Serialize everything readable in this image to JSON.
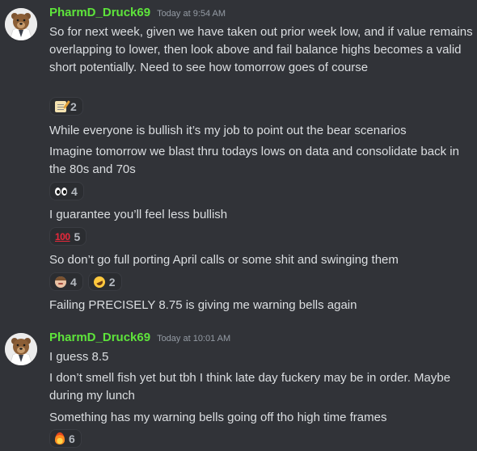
{
  "messages": [
    {
      "username": "PharmD_Druck69",
      "timestamp": "Today at 9:54 AM",
      "lines": [
        "So for next week, given we have taken out prior week low, and if value remains overlapping to lower, then look above and fail balance highs becomes a valid short potentially. Need to see how tomorrow goes of course",
        "While everyone is bullish it’s my job to point out the bear scenarios",
        "Imagine tomorrow we blast thru todays lows on data and consolidate back in the 80s and 70s",
        "I guarantee you’ll feel less bullish",
        "So don’t go full porting April calls or some shit and swinging them",
        "Failing PRECISELY 8.75 is giving me warning bells again"
      ],
      "reactions": [
        {
          "emoji": "memo-emoji",
          "count": "2"
        },
        {
          "emoji": "eyes-emoji",
          "count": "4"
        },
        {
          "emoji": "hundred-points-emoji",
          "count": "5"
        },
        {
          "emoji": "face-emoji",
          "count": "4"
        },
        {
          "emoji": "rolling-laughing-emoji",
          "count": "2"
        }
      ]
    },
    {
      "username": "PharmD_Druck69",
      "timestamp": "Today at 10:01 AM",
      "lines": [
        "I guess 8.5",
        "I don’t smell fish yet but tbh I think late day fuckery may be in order. Maybe during my lunch",
        "Something has my warning bells going off tho high time frames"
      ],
      "reactions": [
        {
          "emoji": "fire-emoji",
          "count": "6"
        }
      ]
    }
  ]
}
